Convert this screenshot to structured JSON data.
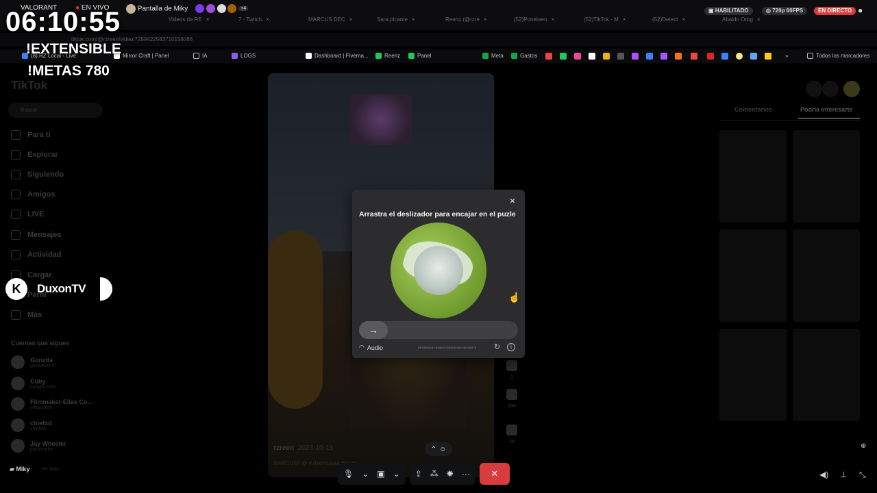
{
  "stream": {
    "timer": "06:10:55",
    "lines": [
      "!EXTENSIBLE",
      "!METAS 780"
    ],
    "streamer_name": "DuxonTV",
    "logo_letter": "K"
  },
  "discord_top": {
    "channel": "VALORANT",
    "live_label": "EN VIVO",
    "screen_label": "Pantalla de Miky",
    "extra_count": "+4",
    "enabled_label": "HABILITADO",
    "quality_label": "720p 60FPS",
    "live_badge": "EN DIRECTO"
  },
  "browser": {
    "tabs": [
      "Videos de RE",
      "7 - Twitch",
      "MARCUS DEC",
      "Sara picante",
      "Reenz (@rzre",
      "(52)Poneteen",
      "(52)TikTok - M",
      "(52)Detect",
      "Abaldo Orbg"
    ],
    "url": "tiktok.com/@rzreen/video/7289422583710158086",
    "bookmarks": [
      "(8) RZ Local - Live",
      "Mirror Craft | Panel",
      "IA",
      "LOGS",
      "Dashboard | Fivema...",
      "Reenz",
      "Panel",
      "Meta",
      "Gastos"
    ],
    "all_bookmarks": "Todos los marcadores"
  },
  "tiktok": {
    "logo": "TikTok",
    "search_placeholder": "Buscar",
    "nav": [
      "Para ti",
      "Explorar",
      "Siguiendo",
      "Amigos",
      "LIVE",
      "Mensajes",
      "Actividad",
      "Cargar",
      "Perfil",
      "Más"
    ],
    "following_title": "Cuentas que sigues",
    "following": [
      {
        "name": "Gonzita",
        "handle": "gonzatwitch"
      },
      {
        "name": "Cuby",
        "handle": "cubypuzzles"
      },
      {
        "name": "Filmmaker-Elias Co...",
        "handle": "eliascofilm"
      },
      {
        "name": "chiefxd",
        "handle": "chiefxd"
      },
      {
        "name": "Jay Wheeler",
        "handle": "jaywheeler"
      }
    ],
    "see_all": "Ver todo",
    "video_user": "rzreen",
    "video_date": "2023-10-13",
    "video_desc": "MARCUS? @ #abiertopara #gtarp",
    "side_counts": [
      "3",
      "180",
      "26"
    ],
    "right_tabs": [
      "Comentarios",
      "Podría interesarte"
    ]
  },
  "captcha": {
    "title": "Arrastra el deslizador para encajar en el puzle",
    "close": "×",
    "slider_arrow": "→",
    "audio_label": "Audio",
    "code": "BBBBBB9ACBAB64CB65F5DB0CBDB5A78",
    "refresh": "↻",
    "info": "i"
  },
  "discord_bottom": {
    "user": "Miky",
    "up_icon": "⌃",
    "mic_icon": "🎙",
    "cam_icon": "▣",
    "share_icon": "⇪",
    "apps_icon": "⁂",
    "more_icon": "···",
    "end_icon": "✕"
  }
}
